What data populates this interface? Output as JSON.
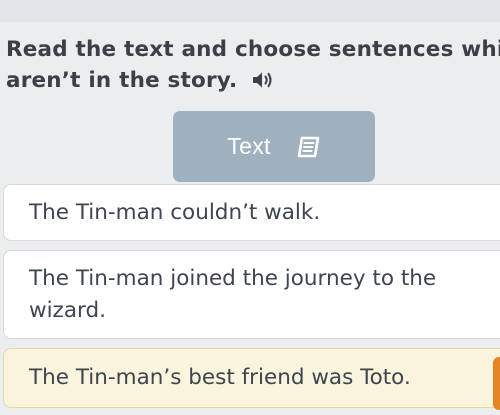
{
  "question": {
    "line1": "Read the text and choose sentences which",
    "line2": "aren’t in the story."
  },
  "text_button": {
    "label": "Text"
  },
  "options": [
    {
      "text": "The Tin-man couldn’t walk.",
      "state": "default"
    },
    {
      "text": "The Tin-man joined the journey to the wizard.",
      "state": "default"
    },
    {
      "text": "The Tin-man’s best friend was Toto.",
      "state": "selected"
    }
  ],
  "icons": {
    "audio": "speaker-icon",
    "text": "book-icon"
  },
  "colors": {
    "background": "#ecedef",
    "text_button": "#9fb1bf",
    "selected_option": "#fbf4dd",
    "selected_marker": "#e58424",
    "heading_text": "#3b4048"
  }
}
